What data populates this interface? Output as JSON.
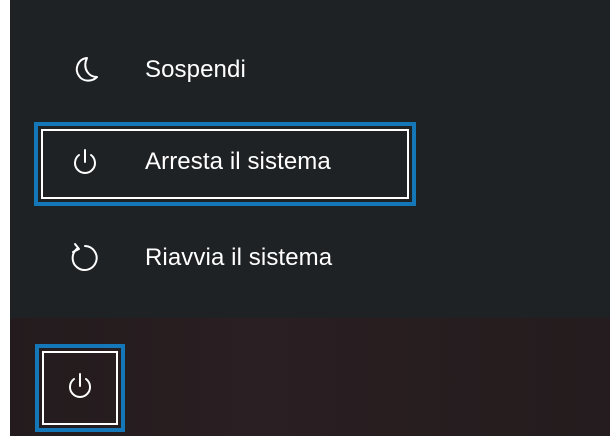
{
  "power_menu": {
    "items": [
      {
        "label": "Sospendi",
        "icon": "moon-icon"
      },
      {
        "label": "Arresta il sistema",
        "icon": "power-icon"
      },
      {
        "label": "Riavvia il sistema",
        "icon": "restart-icon"
      }
    ],
    "highlighted_item": "Arresta il sistema"
  },
  "taskbar": {
    "power_button_icon": "power-icon"
  },
  "colors": {
    "menu_background": "#1f2225",
    "text": "#ffffff",
    "highlight_border": "#1477b8"
  }
}
